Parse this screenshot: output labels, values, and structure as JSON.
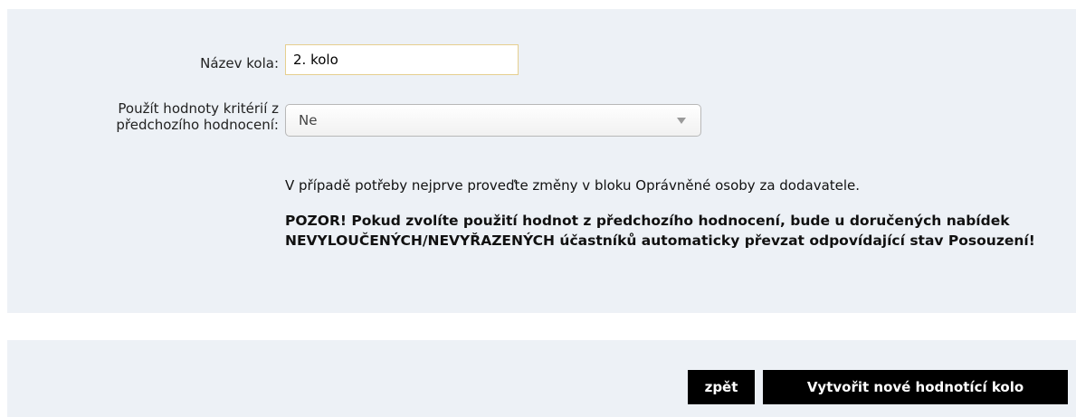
{
  "form": {
    "round_name_label": "Název kola:",
    "round_name_value": "2. kolo",
    "use_values_label_line1": "Použít hodnoty kritérií z",
    "use_values_label_line2": "předchozího hodnocení:",
    "use_values_selected": "Ne",
    "info_text": "V případě potřeby nejprve proveďte změny v bloku Oprávněné osoby za dodavatele.",
    "warning_text": "POZOR! Pokud zvolíte použití hodnot z předchozího hodnocení, bude u doručených nabídek NEVYLOUČENÝCH/NEVYŘAZENÝCH účastníků automaticky převzat odpovídající stav Posouzení!"
  },
  "buttons": {
    "back_label": "zpět",
    "create_label": "Vytvořit nové hodnotící kolo"
  },
  "colors": {
    "panel_background": "#edf1f6",
    "button_background": "#000000",
    "button_text": "#ffffff",
    "input_border": "#e6cf8f"
  },
  "icons": {
    "select_arrow": "chevron-down-icon"
  }
}
